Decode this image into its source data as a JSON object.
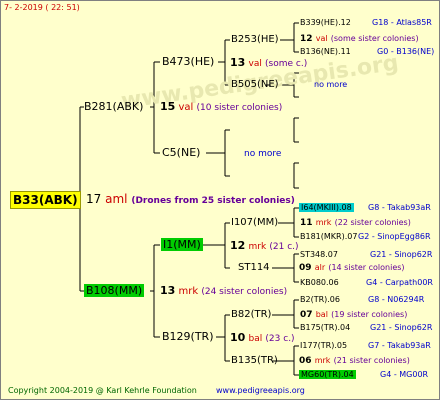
{
  "header": {
    "date": "7-  2-2019 ( 22: 51)"
  },
  "watermark": "www.pedigreeapis.org",
  "root": {
    "id": "B33(ABK)",
    "number": "17",
    "unit": "aml",
    "note": "(Drones from 25 sister colonies)"
  },
  "sire": {
    "id": "B281(ABK)",
    "number": "15",
    "unit": "val",
    "note": "(10 sister colonies)"
  },
  "dam": {
    "id": "B108(MM)",
    "number": "13",
    "unit": "mrk",
    "note": "(24 sister colonies)"
  },
  "sire_sire": {
    "id": "B473(HE)",
    "number": "13",
    "unit": "val",
    "note": "(some c.)"
  },
  "sire_dam": {
    "id": "C5(NE)",
    "note": "no more"
  },
  "dam_sire": {
    "id": "I1(MM)",
    "number": "12",
    "unit": "mrk",
    "note": "(21 c.)"
  },
  "dam_dam": {
    "id": "B129(TR)",
    "number": "10",
    "unit": "bal",
    "note": "(23 c.)"
  },
  "g3": {
    "b253": {
      "id": "B253(HE)"
    },
    "b505": {
      "id": "B505(NE)",
      "note": "no more"
    },
    "i107": {
      "id": "I107(MM)"
    },
    "st114": {
      "id": "ST114",
      "number": "09",
      "unit": "alr",
      "note": "(14 sister colonies)"
    },
    "b82": {
      "id": "B82(TR)"
    },
    "b135": {
      "id": "B135(TR)",
      "number": "06",
      "unit": "mrk",
      "note": "(21 sister colonies)"
    }
  },
  "g4": {
    "b339": {
      "id": "B339(HE).12",
      "code": "G18 - Atlas85R"
    },
    "b253_mid": {
      "number": "12",
      "unit": "val",
      "note": "(some sister colonies)"
    },
    "b136": {
      "id": "B136(NE).11",
      "code": "G0 - B136(NE)"
    },
    "i64": {
      "id": "I64(MKIII).08",
      "code": "G8 - Takab93aR"
    },
    "i107_mid": {
      "number": "11",
      "unit": "mrk",
      "note": "(22 sister colonies)"
    },
    "b181": {
      "id": "B181(MKR).07",
      "code": "G2 - SinopEgg86R"
    },
    "st348": {
      "id": "ST348.07",
      "code": "G21 - Sinop62R"
    },
    "kb080": {
      "id": "KB080.06",
      "code": "G4 - Carpath00R"
    },
    "b2": {
      "id": "B2(TR).06",
      "code": "G8 - N06294R"
    },
    "b82_mid": {
      "number": "07",
      "unit": "bal",
      "note": "(19 sister colonies)"
    },
    "b175": {
      "id": "B175(TR).04",
      "code": "G21 - Sinop62R"
    },
    "i177": {
      "id": "I177(TR).05",
      "code": "G7 - Takab93aR"
    },
    "mg60": {
      "id": "MG60(TR).04",
      "code": "G4 - MG00R"
    }
  },
  "footer": {
    "copyright": "Copyright 2004-2019 @ Karl Kehrle Foundation",
    "site": "www.pedigreeapis.org"
  }
}
